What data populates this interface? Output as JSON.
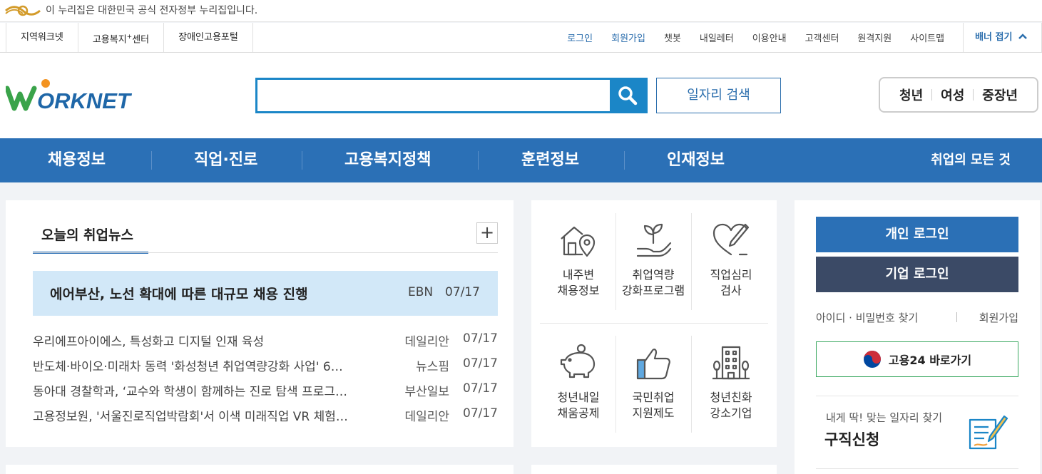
{
  "gov_banner": {
    "text": "이 누리집은 대한민국 공식 전자정부 누리집입니다."
  },
  "top_nav": {
    "left": [
      "지역워크넷",
      "고용복지",
      "장애인고용포털"
    ],
    "welfare_sup": "+",
    "welfare_suffix": "센터",
    "right": [
      "로그인",
      "회원가입",
      "챗봇",
      "내일레터",
      "이용안내",
      "고객센터",
      "원격지원",
      "사이트맵"
    ],
    "fold_label": "배너 접기"
  },
  "header": {
    "logo_text": "ORKNET",
    "search_placeholder": "",
    "job_search_label": "일자리 검색",
    "targets": [
      "청년",
      "여성",
      "중장년"
    ]
  },
  "gnb": {
    "menus": [
      "채용정보",
      "직업·진로",
      "고용복지정책",
      "훈련정보",
      "인재정보"
    ],
    "all_label": "취업의 모든 것"
  },
  "news": {
    "tab_label": "오늘의 취업뉴스",
    "more": "+",
    "headline": {
      "title": "에어부산, 노선 확대에 따른 대규모 채용 진행",
      "source": "EBN",
      "date": "07/17"
    },
    "items": [
      {
        "title": "우리에프아이에스, 특성화고 디지털 인재 육성",
        "source": "데일리안",
        "date": "07/17"
      },
      {
        "title": "반도체·바이오·미래차 동력 '화성청년 취업역량강화 사업' 6…",
        "source": "뉴스핌",
        "date": "07/17"
      },
      {
        "title": "동아대 경찰학과, ‘교수와 학생이 함께하는 진로 탐색 프로그…",
        "source": "부산일보",
        "date": "07/17"
      },
      {
        "title": "고용정보원, '서울진로직업박람회'서 이색 미래직업 VR 체험…",
        "source": "데일리안",
        "date": "07/17"
      }
    ]
  },
  "services": [
    {
      "label": "내주변\n채용정보",
      "icon": "house-location-icon"
    },
    {
      "label": "취업역량\n강화프로그램",
      "icon": "sprout-hand-icon"
    },
    {
      "label": "직업심리\n검사",
      "icon": "heart-pen-icon"
    },
    {
      "label": "청년내일\n채움공제",
      "icon": "piggy-bank-icon"
    },
    {
      "label": "국민취업\n지원제도",
      "icon": "thumbs-up-icon"
    },
    {
      "label": "청년친화\n강소기업",
      "icon": "building-icon"
    }
  ],
  "login": {
    "personal": "개인 로그인",
    "company": "기업 로그인",
    "find": "아이디 · 비밀번호 찾기",
    "join": "회원가입",
    "goyong24": "고용24 바로가기",
    "apply_sub": "내게 딱! 맞는 일자리 찾기",
    "apply_main": "구직신청"
  },
  "colors": {
    "primary": "#2b70b6",
    "search_blue": "#1b86c7",
    "company_btn": "#3b4a66",
    "headline_bg": "#d2e8f8",
    "green": "#3aa860"
  }
}
